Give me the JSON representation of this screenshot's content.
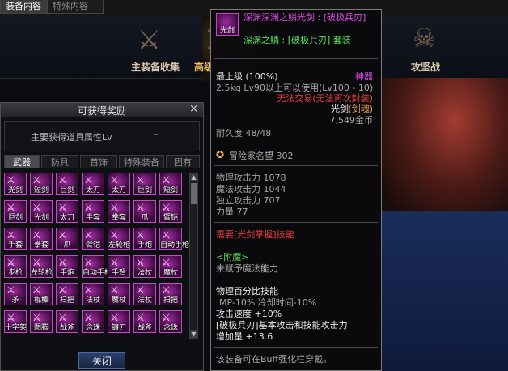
{
  "top_tabs": [
    "装备内容",
    "特殊内容"
  ],
  "menu": [
    {
      "label": "主装备收集",
      "icon": "crossed-swords-icon"
    },
    {
      "label": "高级",
      "icon": "helmet-icon"
    },
    {
      "label": "攻坚战",
      "icon": "demon-skull-icon"
    }
  ],
  "reward_window": {
    "title": "可获得奖励",
    "close": "×",
    "attr_label": "主要获得道具属性Lv",
    "attr_value": "–",
    "tabs": [
      "武器",
      "防具",
      "首饰",
      "特殊装备",
      "固有"
    ],
    "active_tab": 0,
    "items": [
      "光剑",
      "短剑",
      "巨剑",
      "太刀",
      "太刀",
      "巨剑",
      "短剑",
      "巨剑",
      "光剑",
      "太刀",
      "手套",
      "拳套",
      "爪",
      "臂铠",
      "手套",
      "拳套",
      "爪",
      "臂铠",
      "左轮枪",
      "手炮",
      "自动手枪",
      "步枪",
      "左轮枪",
      "手炮",
      "自动手枪",
      "手弩",
      "法杖",
      "魔杖",
      "矛",
      "棍棒",
      "扫把",
      "法杖",
      "魔杖",
      "法杖",
      "扫把",
      "十字架",
      "图腾",
      "战斧",
      "念珠",
      "镰刀",
      "战斧",
      "念珠"
    ],
    "close_button": "关闭"
  },
  "tooltip": {
    "icon_caption": "光剑",
    "name": "深渊深渊之鳞光剑 : [破极兵刃]",
    "set": "深渊之鳞 : [破极兵刃] 套装",
    "grade": "最上级 (100%)",
    "rarity": "神器",
    "weight_level": "2.5kg  Lv90以上可以使用(Lv100 - 10)",
    "trade": "无法交易(无法再次封装)",
    "type": "光剑",
    "type_sub": "(剑魂)",
    "price": "7,549金币",
    "durability": "耐久度 48/48",
    "fame": "冒险家名望 302",
    "stats": [
      "物理攻击力 1078",
      "魔法攻击力 1044",
      "独立攻击力 707",
      "力量 77"
    ],
    "requirement": "需要[光剑掌握]技能",
    "enchant_title": "<附魔>",
    "enchant_value": "未赋予魔法能力",
    "skill_line1": "物理百分比技能",
    "skill_line2": "MP-10% 冷却时间-10%",
    "speed_line": "攻击速度 +10%",
    "bonus_line1": "[破极兵刃]基本攻击和技能攻击力",
    "bonus_line2": "增加量 +13.6",
    "buff_line": "该装备可在Buff强化栏穿戴。"
  }
}
